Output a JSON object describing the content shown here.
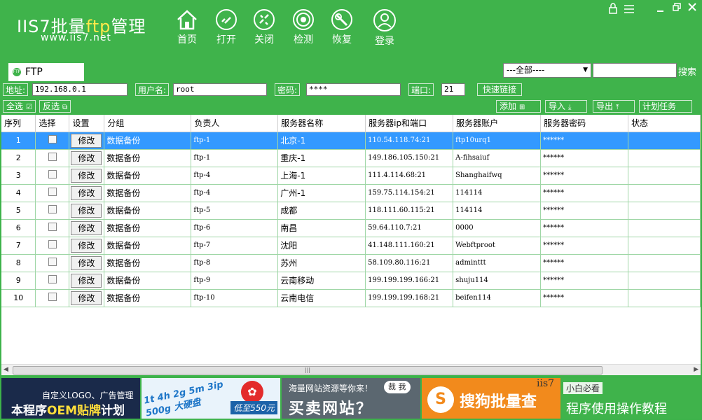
{
  "app": {
    "logo_title_prefix": "IIS7批量",
    "logo_title_ftp": "ftp",
    "logo_title_suffix": "管理",
    "logo_url": "www.iis7.net"
  },
  "nav": [
    {
      "label": "首页",
      "icon": "home-icon"
    },
    {
      "label": "打开",
      "icon": "link-icon"
    },
    {
      "label": "关闭",
      "icon": "unlink-icon"
    },
    {
      "label": "检测",
      "icon": "detect-icon"
    },
    {
      "label": "恢复",
      "icon": "restore-icon"
    },
    {
      "label": "登录",
      "icon": "user-icon"
    }
  ],
  "window_controls": {
    "lock": "lock-icon",
    "menu": "menu-icon",
    "minimize": "—",
    "restore": "▢",
    "close": "✕"
  },
  "tab": {
    "label": "FTP",
    "icon_text": "FTP"
  },
  "filter": {
    "selected": "---全部----",
    "options_visible": [
      "---全部----"
    ]
  },
  "search": {
    "value": "",
    "button": "搜索"
  },
  "connection": {
    "address_label": "地址:",
    "address_value": "192.168.0.1",
    "username_label": "用户名:",
    "username_value": "root",
    "password_label": "密码:",
    "password_value": "****",
    "port_label": "端口:",
    "port_value": "21",
    "quick_connect": "快速链接"
  },
  "actions": {
    "select_all": "全选",
    "invert": "反选",
    "add": "添加",
    "import": "导入",
    "export": "导出",
    "schedule": "计划任务"
  },
  "table": {
    "columns": [
      "序列",
      "选择",
      "设置",
      "分组",
      "负责人",
      "服务器名称",
      "服务器ip和端口",
      "服务器账户",
      "服务器密码",
      "状态"
    ],
    "edit_label": "修改",
    "rows": [
      {
        "idx": "1",
        "group": "数据备份",
        "owner": "ftp-1",
        "name": "北京-1",
        "ip": "110.54.118.74:21",
        "account": "ftp10urq1",
        "password": "******",
        "status": "",
        "selected": true
      },
      {
        "idx": "2",
        "group": "数据备份",
        "owner": "ftp-1",
        "name": "重庆-1",
        "ip": "149.186.105.150:21",
        "account": "A-fihsaiuf",
        "password": "******",
        "status": "",
        "selected": false
      },
      {
        "idx": "3",
        "group": "数据备份",
        "owner": "ftp-4",
        "name": "上海-1",
        "ip": "111.4.114.68:21",
        "account": "Shanghaifwq",
        "password": "******",
        "status": "",
        "selected": false
      },
      {
        "idx": "4",
        "group": "数据备份",
        "owner": "ftp-4",
        "name": "广州-1",
        "ip": "159.75.114.154:21",
        "account": "114114",
        "password": "******",
        "status": "",
        "selected": false
      },
      {
        "idx": "5",
        "group": "数据备份",
        "owner": "ftp-5",
        "name": "成都",
        "ip": "118.111.60.115:21",
        "account": "114114",
        "password": "******",
        "status": "",
        "selected": false
      },
      {
        "idx": "6",
        "group": "数据备份",
        "owner": "ftp-6",
        "name": "南昌",
        "ip": "59.64.110.7:21",
        "account": "0000",
        "password": "******",
        "status": "",
        "selected": false
      },
      {
        "idx": "7",
        "group": "数据备份",
        "owner": "ftp-7",
        "name": "沈阳",
        "ip": "41.148.111.160:21",
        "account": "Webftproot",
        "password": "******",
        "status": "",
        "selected": false
      },
      {
        "idx": "8",
        "group": "数据备份",
        "owner": "ftp-8",
        "name": "苏州",
        "ip": "58.109.80.116:21",
        "account": "adminttt",
        "password": "******",
        "status": "",
        "selected": false
      },
      {
        "idx": "9",
        "group": "数据备份",
        "owner": "ftp-9",
        "name": "云南移动",
        "ip": "199.199.199.166:21",
        "account": "shuju114",
        "password": "******",
        "status": "",
        "selected": false
      },
      {
        "idx": "10",
        "group": "数据备份",
        "owner": "ftp-10",
        "name": "云南电信",
        "ip": "199.199.199.168:21",
        "account": "beifen114",
        "password": "******",
        "status": "",
        "selected": false
      }
    ]
  },
  "banners": {
    "b1_line1": "自定义LOGO、广告管理",
    "b1_line2_a": "本程序",
    "b1_line2_b": "OEM贴牌",
    "b1_line2_c": "计划",
    "b2_line1": "1t 4h 2g 5m 3ip",
    "b2_line2": "500g 大硬盘",
    "b2_price": "低至550元",
    "b3_line1": "海量网站资源等你来！",
    "b3_badge": "裁 我",
    "b3_line2": "买卖网站？",
    "b4_tag": "iis7",
    "b4_logo": "S",
    "b4_line1": "搜狗批量查",
    "b5_line1": "小白必看",
    "b5_line2": "程序使用操作教程"
  },
  "colors": {
    "brand_green": "#3fb34b",
    "selection_blue": "#3399ff",
    "grid_green": "#9fd6a6"
  }
}
